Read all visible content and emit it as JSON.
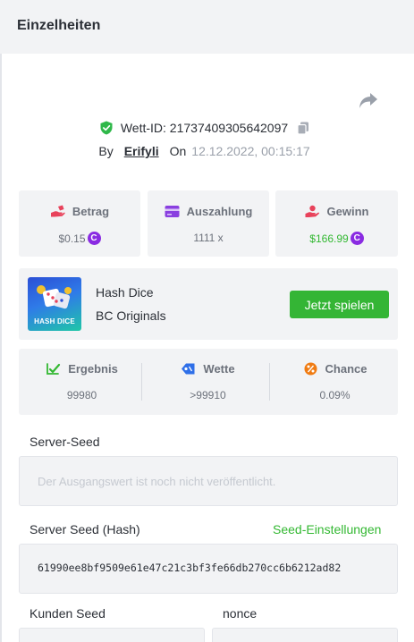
{
  "header": {
    "title": "Einzelheiten"
  },
  "bet": {
    "id_label": "Wett-ID: 21737409305642097",
    "by_label": "By",
    "username": "Erifyli",
    "on_label": "On",
    "date": "12.12.2022, 00:15:17"
  },
  "stats": {
    "amount": {
      "label": "Betrag",
      "value": "$0.15",
      "coin": "C"
    },
    "payout": {
      "label": "Auszahlung",
      "value": "1111 x"
    },
    "profit": {
      "label": "Gewinn",
      "value": "$166.99",
      "coin": "C"
    }
  },
  "game": {
    "thumb_text": "HASH DICE",
    "name": "Hash Dice",
    "provider": "BC Originals",
    "play_label": "Jetzt spielen"
  },
  "result": {
    "outcome": {
      "label": "Ergebnis",
      "value": "99980"
    },
    "bet": {
      "label": "Wette",
      "value": ">99910"
    },
    "chance": {
      "label": "Chance",
      "value": "0.09%"
    }
  },
  "seeds": {
    "server_seed_label": "Server-Seed",
    "server_seed_placeholder": "Der Ausgangswert ist noch nicht veröffentlicht.",
    "server_hash_label": "Server Seed (Hash)",
    "seed_settings_label": "Seed-Einstellungen",
    "server_hash_value": "61990ee8bf9509e61e47c21c3bf3fe66db270cc6b6212ad82",
    "client_seed_label": "Kunden Seed",
    "nonce_label": "nonce"
  },
  "colors": {
    "accent_green": "#34b535",
    "coin_purple": "#8a2be2",
    "card_bg": "#f2f3f5"
  }
}
